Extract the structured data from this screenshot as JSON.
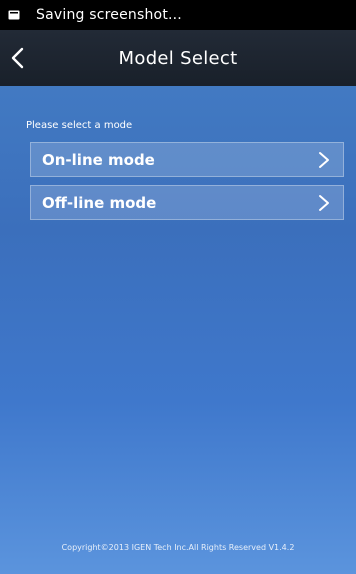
{
  "status_bar": {
    "icon": "screenshot-icon",
    "text": "Saving screenshot..."
  },
  "header": {
    "back_icon": "chevron-left-icon",
    "title": "Model Select"
  },
  "main": {
    "prompt": "Please select a mode",
    "modes": [
      {
        "label": "On-line mode",
        "icon": "chevron-right-icon"
      },
      {
        "label": "Off-line mode",
        "icon": "chevron-right-icon"
      }
    ]
  },
  "footer": {
    "copyright": "Copyright©2013 IGEN Tech Inc.All Rights Reserved V1.4.2"
  },
  "colors": {
    "status_bar_bg": "#000000",
    "title_bar_bg": "#1f2630",
    "background_top": "#4680c6",
    "background_bottom": "#5b94dd",
    "text": "#ffffff"
  }
}
